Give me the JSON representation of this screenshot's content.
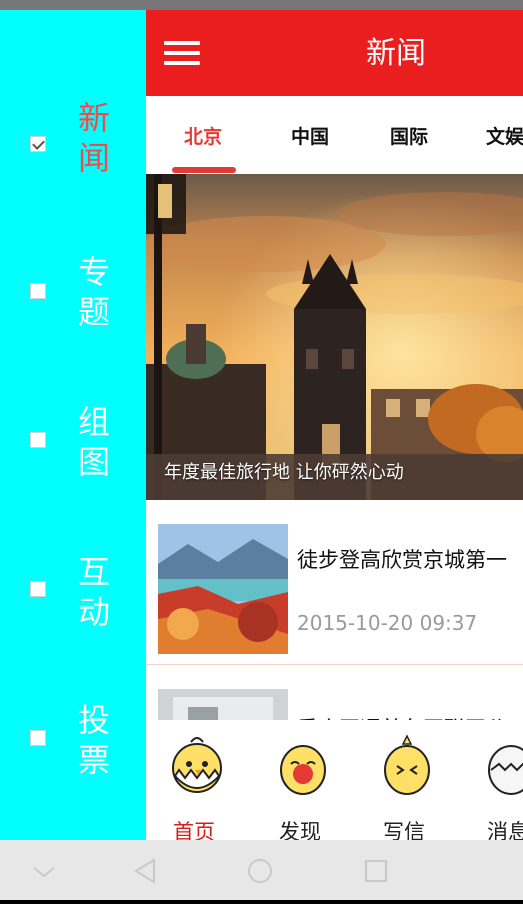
{
  "drawer": {
    "items": [
      {
        "label": "新闻",
        "checked": true
      },
      {
        "label": "专题",
        "checked": false
      },
      {
        "label": "组图",
        "checked": false
      },
      {
        "label": "互动",
        "checked": false
      },
      {
        "label": "投票",
        "checked": false
      }
    ]
  },
  "appbar": {
    "title": "新闻",
    "menu_icon": "hamburger-menu-icon"
  },
  "tabs": [
    "北京",
    "中国",
    "国际",
    "文娱"
  ],
  "hero": {
    "caption": "年度最佳旅行地 让你砰然心动"
  },
  "news": [
    {
      "title": "徒步登高欣赏京城第一",
      "time": "2015-10-20 09:37"
    },
    {
      "title": "重庆开通首条互联网公"
    }
  ],
  "bottom_nav": [
    {
      "label": "首页",
      "icon": "home-chick-icon"
    },
    {
      "label": "发现",
      "icon": "discover-chick-icon"
    },
    {
      "label": "写信",
      "icon": "write-chick-icon"
    },
    {
      "label": "消息",
      "icon": "message-chick-icon"
    }
  ],
  "colors": {
    "drawer_bg": "#00FFFF",
    "appbar_bg": "#EA1E1E",
    "accent": "#E53935",
    "inactive_drawer_text": "#FFFFFF",
    "active_drawer_text": "#F24A4A"
  }
}
